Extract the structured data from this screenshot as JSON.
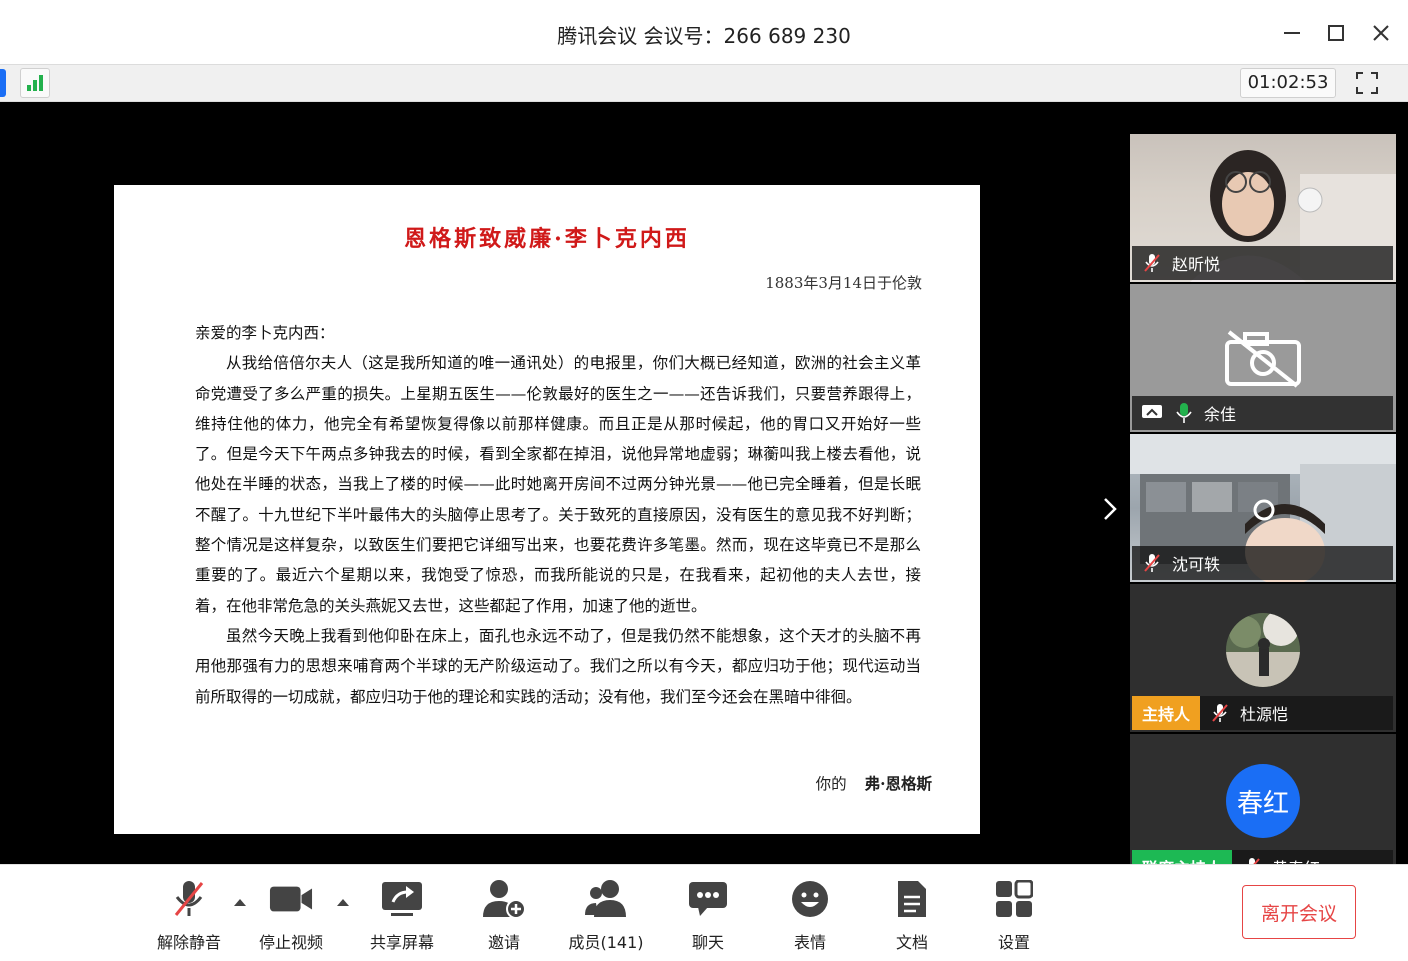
{
  "window": {
    "title": "腾讯会议 会议号：266 689 230"
  },
  "status": {
    "timer": "01:02:53"
  },
  "document": {
    "title": "恩格斯致威廉·李卜克内西",
    "date": "1883年3月14日于伦敦",
    "salutation": "亲爱的李卜克内西：",
    "paragraphs": [
      "从我给倍倍尔夫人（这是我所知道的唯一通讯处）的电报里，你们大概已经知道，欧洲的社会主义革命党遭受了多么严重的损失。上星期五医生——伦敦最好的医生之一——还告诉我们，只要营养跟得上，维持住他的体力，他完全有希望恢复得像以前那样健康。而且正是从那时候起，他的胃口又开始好一些了。但是今天下午两点多钟我去的时候，看到全家都在掉泪，说他异常地虚弱；琳蘅叫我上楼去看他，说他处在半睡的状态，当我上了楼的时候——此时她离开房间不过两分钟光景——他已完全睡着，但是长眠不醒了。十九世纪下半叶最伟大的头脑停止思考了。关于致死的直接原因，没有医生的意见我不好判断；整个情况是这样复杂，以致医生们要把它详细写出来，也要花费许多笔墨。然而，现在这毕竟已不是那么重要的了。最近六个星期以来，我饱受了惊恐，而我所能说的只是，在我看来，起初他的夫人去世，接着，在他非常危急的关头燕妮又去世，这些都起了作用，加速了他的逝世。",
      "虽然今天晚上我看到他仰卧在床上，面孔也永远不动了，但是我仍然不能想象，这个天才的头脑不再用他那强有力的思想来哺育两个半球的无产阶级运动了。我们之所以有今天，都应归功于他；现代运动当前所取得的一切成就，都应归功于他的理论和实践的活动；没有他，我们至今还会在黑暗中徘徊。"
    ],
    "closing": "你的",
    "signature": "弗·恩格斯"
  },
  "participants": [
    {
      "name": "赵昕悦",
      "mic": "muted"
    },
    {
      "name": "余佳",
      "mic": "on",
      "sharing": true
    },
    {
      "name": "沈可轶",
      "mic": "muted"
    },
    {
      "name": "杜源恺",
      "mic": "muted",
      "badge": "主持人"
    },
    {
      "name": "黄春红",
      "mic": "muted",
      "avatar": "春红",
      "badge": "联席主持人"
    }
  ],
  "toolbar": {
    "unmute": "解除静音",
    "stop_video": "停止视频",
    "share_screen": "共享屏幕",
    "invite": "邀请",
    "members": "成员(141)",
    "chat": "聊天",
    "reactions": "表情",
    "docs": "文档",
    "settings": "设置",
    "leave": "离开会议"
  },
  "colors": {
    "accent_red": "#e64545",
    "doc_title": "#d01919",
    "host_badge": "#f0a020",
    "cohost_badge": "#1db954",
    "avatar_blue": "#1a6ef5",
    "signal_green": "#23b14d"
  }
}
